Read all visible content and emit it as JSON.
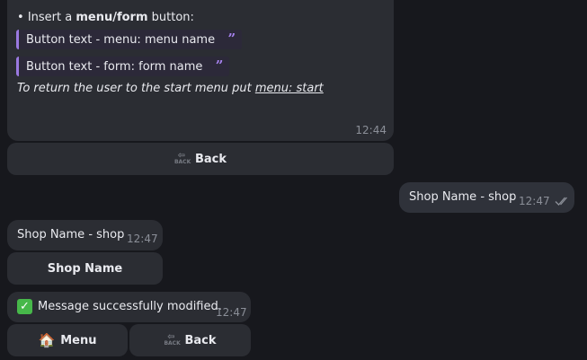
{
  "messages": {
    "instructions": {
      "bullet": "• ",
      "insert_prefix": "Insert a ",
      "insert_bold": "menu/form",
      "insert_suffix": " button:",
      "quote_menu": "Button text - menu: menu name",
      "quote_form": "Button text - form: form name",
      "return_text": "To return the user to the start menu put ",
      "return_link": "menu: start",
      "time": "12:44"
    },
    "outgoing": {
      "text": "Shop Name - shop",
      "time": "12:47",
      "read_icon": "double-check-icon"
    },
    "incoming_shop": {
      "text": "Shop Name - shop",
      "time": "12:47",
      "button": "Shop Name"
    },
    "success": {
      "icon": "check-mark-emoji",
      "text": "Message successfully modified.",
      "time": "12:47"
    }
  },
  "buttons": {
    "back_top": {
      "label": "Back",
      "icon": "back-arrow-icon",
      "icon_text": "BACK"
    },
    "menu": {
      "label": "Menu",
      "icon": "house-emoji"
    },
    "back_bottom": {
      "label": "Back",
      "icon": "back-arrow-icon",
      "icon_text": "BACK"
    }
  },
  "colors": {
    "background": "#17181d",
    "bubble": "#2b2d33",
    "quote_accent": "#9a79e0",
    "check_green": "#47b84a"
  }
}
